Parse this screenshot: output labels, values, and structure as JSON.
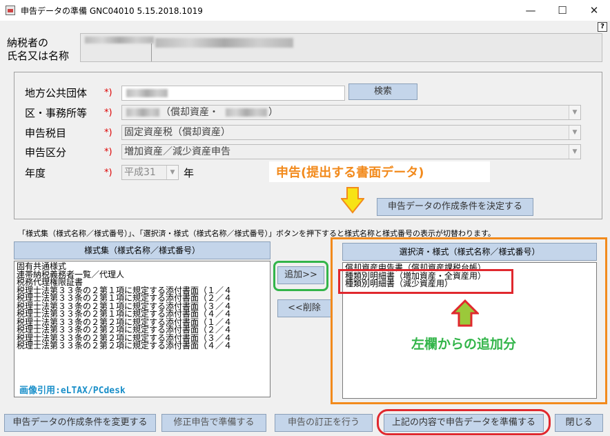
{
  "window": {
    "title": "申告データの準備 GNC04010  5.15.2018.1019",
    "minimize": "—",
    "maximize": "☐",
    "close": "✕",
    "help": "?"
  },
  "taxpayer": {
    "label_line1": "納税者の",
    "label_line2": "氏名又は名称"
  },
  "form": {
    "local_gov": {
      "label": "地方公共団体",
      "req": "*)",
      "search": "検索"
    },
    "office": {
      "label": "区・事務所等",
      "req": "*)",
      "value_mid": "（償却資産・",
      "value_end": "）"
    },
    "tax_item": {
      "label": "申告税目",
      "req": "*)",
      "value": "固定資産税（償却資産）"
    },
    "category": {
      "label": "申告区分",
      "req": "*)",
      "value": "増加資産／減少資産申告"
    },
    "year": {
      "label": "年度",
      "req": "*)",
      "value": "平成31",
      "unit": "年"
    },
    "decide_button": "申告データの作成条件を決定する"
  },
  "annotations": {
    "submission": "申告(提出する書面データ)",
    "added_from_left": "左欄からの追加分",
    "credit": "画像引用:eLTAX/PCdesk"
  },
  "note": "「様式集（様式名称／様式番号）」、「選択済・様式（様式名称／様式番号）」ボタンを押下すると様式名称と様式番号の表示が切替わります。",
  "left_list": {
    "header": "様式集（様式名称／様式番号）",
    "items": [
      "固有共通様式",
      "連帯納税義務者一覧／代理人",
      "税務代理権限証書",
      "税理士法第３３条の２第１項に規定する添付書面（１／４",
      "税理士法第３３条の２第１項に規定する添付書面（２／４",
      "税理士法第３３条の２第１項に規定する添付書面（３／４",
      "税理士法第３３条の２第１項に規定する添付書面（４／４",
      "税理士法第３３条の２第２項に規定する添付書面（１／４",
      "税理士法第３３条の２第２項に規定する添付書面（２／４",
      "税理士法第３３条の２第２項に規定する添付書面（３／４",
      "税理士法第３３条の２第２項に規定する添付書面（４／４"
    ]
  },
  "middle": {
    "add": "追加>>",
    "remove": "<<削除"
  },
  "right_list": {
    "header": "選択済・様式（様式名称／様式番号）",
    "items": [
      "償却資産申告書（償却資産課税台帳）",
      "種類別明細書（増加資産・全資産用）",
      "種類別明細書（減少資産用）"
    ]
  },
  "bottom": {
    "change_conditions": "申告データの作成条件を変更する",
    "amend": "修正申告で準備する",
    "correct": "申告の訂正を行う",
    "prepare": "上記の内容で申告データを準備する",
    "close": "閉じる"
  },
  "colors": {
    "orange": "#f28a1c",
    "green": "#33b54a",
    "red": "#e0282e",
    "button": "#c4d5ea"
  }
}
